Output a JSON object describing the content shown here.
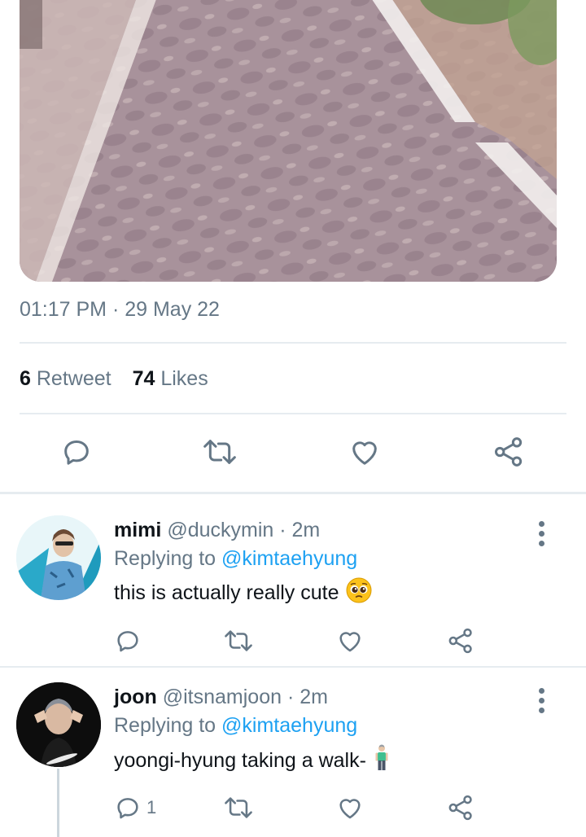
{
  "tweet": {
    "timestamp": "01:17 PM · 29 May 22",
    "retweet_count": "6",
    "retweet_label": "Retweet",
    "likes_count": "74",
    "likes_label": "Likes"
  },
  "replies": [
    {
      "name": "mimi",
      "handle": "@duckymin",
      "time": "· 2m",
      "replying_to_label": "Replying to",
      "replying_to_handle": "@kimtaehyung",
      "text": "this is actually really cute",
      "emoji": "🥺",
      "reply_count": ""
    },
    {
      "name": "joon",
      "handle": "@itsnamjoon",
      "time": "· 2m",
      "replying_to_label": "Replying to",
      "replying_to_handle": "@kimtaehyung",
      "text": "yoongi-hyung taking a walk-",
      "emoji": "🧍‍♂️",
      "reply_count": "1"
    }
  ],
  "icons": {
    "reply": "reply-icon",
    "retweet": "retweet-icon",
    "like": "heart-icon",
    "share": "share-icon",
    "more": "more-vertical-icon"
  },
  "colors": {
    "accent": "#1da1f2",
    "muted": "#657786",
    "divider": "#e6ecf0"
  }
}
